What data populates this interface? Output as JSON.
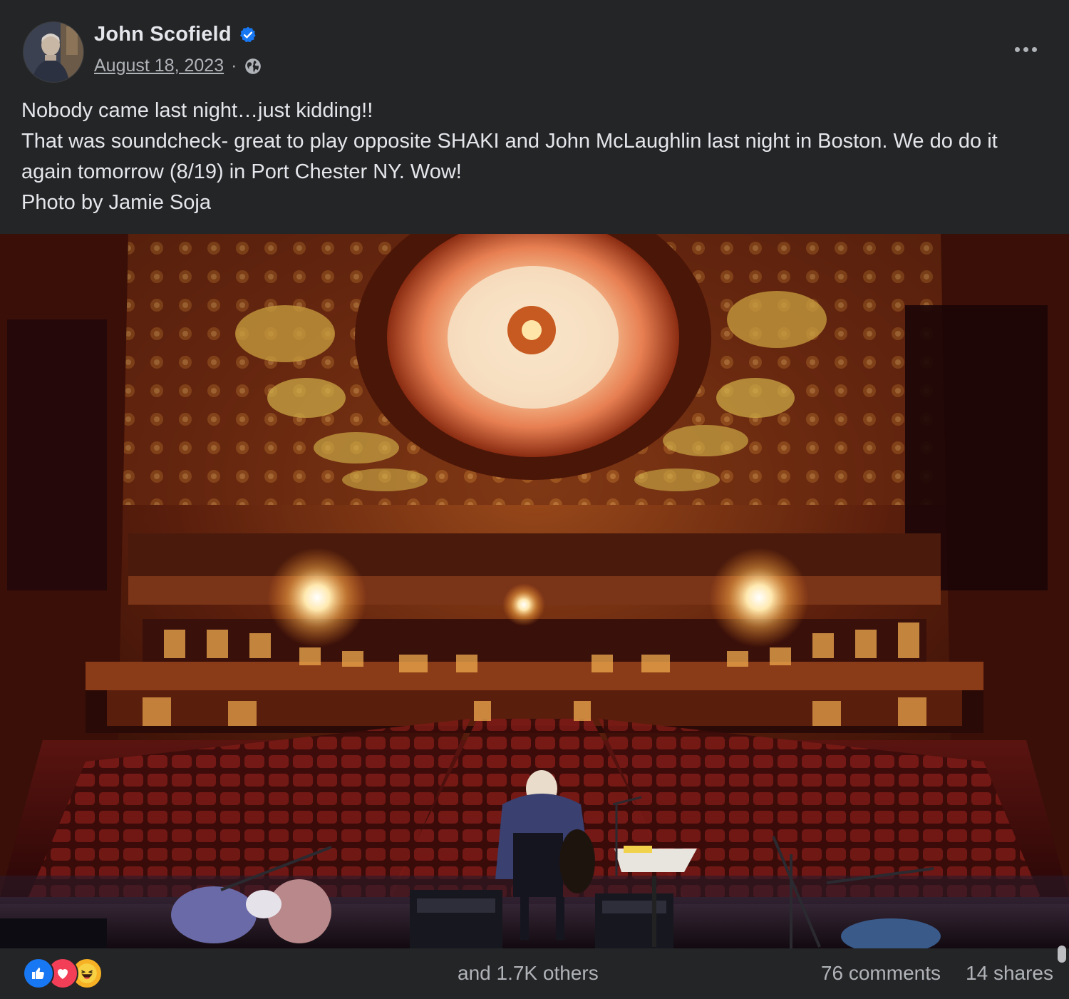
{
  "post": {
    "author": "John Scofield",
    "date": "August 18, 2023",
    "date_separator": "·",
    "verified_icon": "verified-badge-icon",
    "audience_icon": "globe-icon",
    "more_icon": "more-options-icon",
    "text_lines": [
      "Nobody came last night…just kidding!!",
      "That was soundcheck- great to play opposite SHAKI and John McLaughlin last night in Boston. We do do it again tomorrow (8/19) in Port Chester NY. Wow!",
      "Photo by Jamie Soja"
    ],
    "photo_icon": "concert-hall-photo"
  },
  "footer": {
    "reactions": [
      "like-icon",
      "love-icon",
      "haha-icon"
    ],
    "reaction_summary": "and 1.7K others",
    "comments": "76 comments",
    "shares": "14 shares"
  },
  "colors": {
    "background": "#242526",
    "primary_text": "#e4e6eb",
    "secondary_text": "#b0b3b8",
    "verified_blue": "#1877f2",
    "like_blue": "#1877f2",
    "love_red": "#f33e58",
    "haha_yellow": "#f7b125"
  }
}
